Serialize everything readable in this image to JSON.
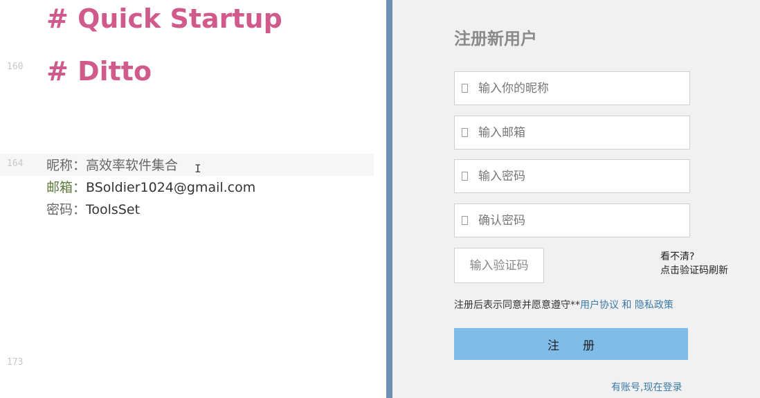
{
  "editor": {
    "headings": [
      "# Quick Startup",
      "# Ditto"
    ],
    "line_numbers": [
      "160",
      "164",
      "173"
    ],
    "lines": [
      {
        "key": "昵称：",
        "value": "高效率软件集合"
      },
      {
        "key": "邮箱：",
        "value": "BSoldier1024@gmail.com"
      },
      {
        "key": "密码：",
        "value": "ToolsSet"
      }
    ],
    "cursor_glyph": "I"
  },
  "register": {
    "title": "注册新用户",
    "fields": [
      {
        "placeholder": "输入你的昵称",
        "icon": "user-icon"
      },
      {
        "placeholder": "输入邮箱",
        "icon": "mail-icon"
      },
      {
        "placeholder": "输入密码",
        "icon": "lock-icon"
      },
      {
        "placeholder": "确认密码",
        "icon": "lock-icon"
      }
    ],
    "captcha_placeholder": "输入验证码",
    "captcha_hint_line1": "看不清?",
    "captcha_hint_line2": "点击验证码刷新",
    "agreement_prefix": "注册后表示同意并愿意遵守**",
    "agreement_link_user": "用户协议",
    "agreement_and": " 和 ",
    "agreement_link_privacy": "隐私政策",
    "submit_label": "注　　册",
    "login_link": "有账号,现在登录"
  },
  "colors": {
    "heading": "#d05a8c",
    "divider": "#6f8fb3",
    "button": "#7fbce8",
    "link": "#3a7aa8"
  }
}
